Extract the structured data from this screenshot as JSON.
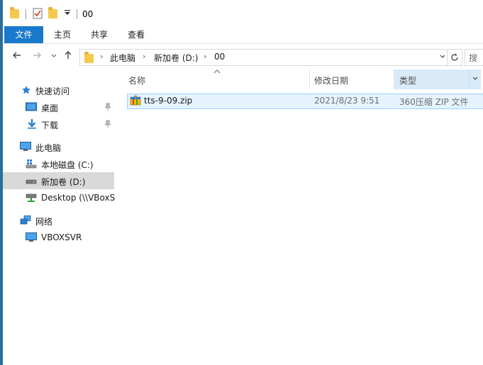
{
  "window": {
    "title": "00"
  },
  "ribbon": {
    "tabs": [
      {
        "label": "文件",
        "active": true
      },
      {
        "label": "主页"
      },
      {
        "label": "共享"
      },
      {
        "label": "查看"
      }
    ]
  },
  "address": {
    "crumbs": [
      "此电脑",
      "新加卷 (D:)",
      "00"
    ],
    "search_placeholder": "搜"
  },
  "navpane": {
    "quick_access": "快速访问",
    "desktop": "桌面",
    "downloads": "下载",
    "this_pc": "此电脑",
    "local_disk": "本地磁盘 (C:)",
    "new_volume": "新加卷 (D:)",
    "desktop_share": "Desktop (\\\\VBoxS",
    "network": "网络",
    "vboxsvr": "VBOXSVR"
  },
  "columns": {
    "name": "名称",
    "date": "修改日期",
    "type": "类型"
  },
  "files": [
    {
      "name": "tts-9-09.zip",
      "date": "2021/8/23 9:51",
      "type": "360压缩 ZIP 文件"
    }
  ],
  "colors": {
    "accent": "#1979ca",
    "selection": "#e5f3ff",
    "selection_border": "#99d1ff",
    "nav_selected": "#d9d9d9"
  }
}
